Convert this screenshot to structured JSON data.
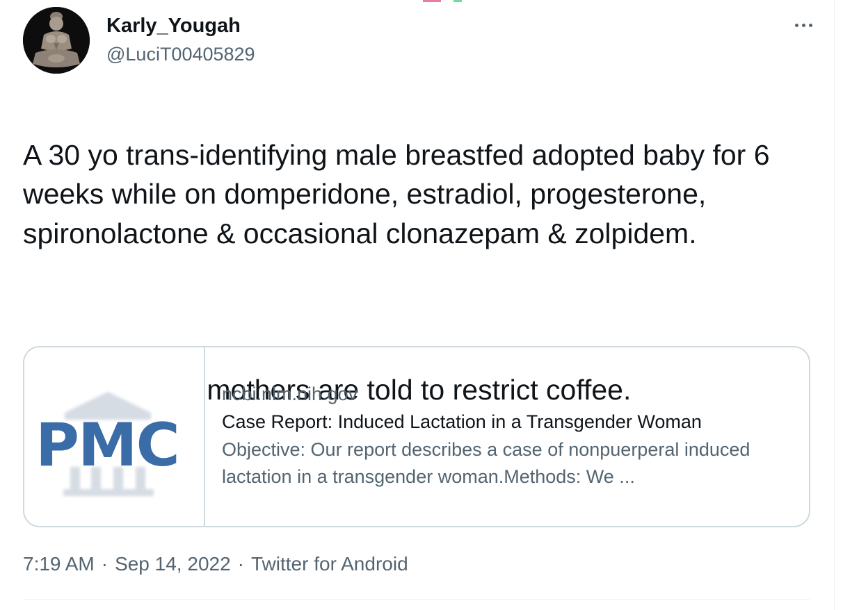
{
  "tweet": {
    "author": {
      "display_name": "Karly_Yougah",
      "handle": "@LuciT00405829"
    },
    "more_icon": "ellipsis-icon",
    "text_paragraphs": [
      "A 30 yo trans-identifying male breastfed adopted baby for 6 weeks while on domperidone, estradiol, progesterone, spironolactone & occasional clonazepam & zolpidem.",
      "Breastfeeding mothers are told to restrict coffee."
    ],
    "link_card": {
      "thumbnail_logo_text": "PMC",
      "domain": "ncbi.nlm.nih.gov",
      "title": "Case Report: Induced Lactation in a Transgender Woman",
      "description": "Objective: Our report describes a case of nonpuerperal induced lactation in a transgender woman.Methods: We ..."
    },
    "meta": {
      "time": "7:19 AM",
      "separator": "·",
      "date": "Sep 14, 2022",
      "source": "Twitter for Android"
    }
  },
  "colors": {
    "text_primary": "#0f1419",
    "text_secondary": "#536471",
    "border": "#cfd9de",
    "pmc_blue": "#3a6da8"
  }
}
